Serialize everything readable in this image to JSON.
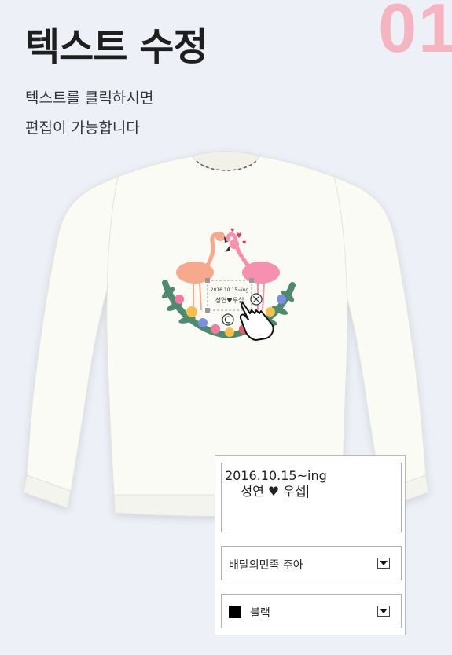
{
  "step_number": "01",
  "title": "텍스트 수정",
  "description": [
    "텍스트를 클릭하시면",
    "편집이 가능합니다"
  ],
  "preview": {
    "line1": "2016.10.15~ing",
    "line2": "성연♥우섭"
  },
  "editor": {
    "text_value": "2016.10.15~ing\n    성연 ♥ 우섭",
    "font_select": "배달의민족 주아",
    "color_select": "블랙",
    "color_swatch": "#000000"
  },
  "colors": {
    "accent": "#f4b5c0",
    "background": "#eef0f8",
    "shirt": "#fbfbf6",
    "flamingo_left": "#f6a98c",
    "flamingo_right": "#f78fb0"
  },
  "icons": [
    "pointer-hand-icon",
    "delete-handle-icon",
    "rotate-handle-icon",
    "heart-icon",
    "dropdown-arrow-icon"
  ]
}
